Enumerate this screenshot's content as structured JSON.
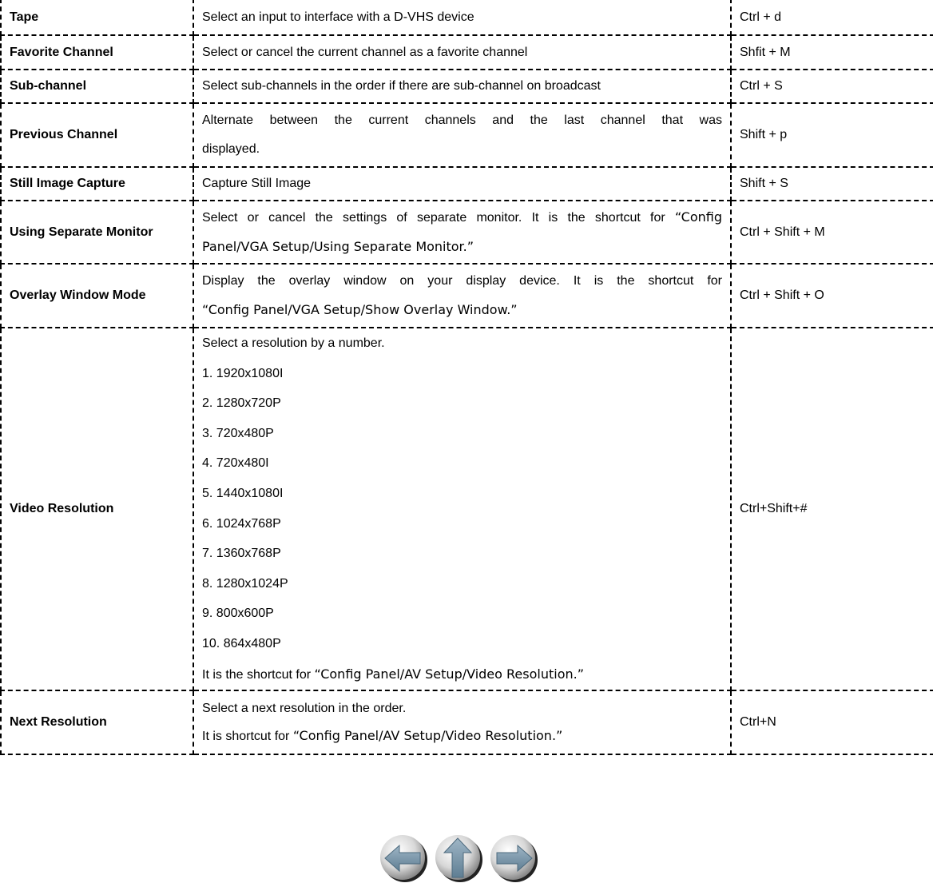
{
  "rows": [
    {
      "name": "Tape",
      "desc": "Select an input to interface with a D-VHS device",
      "shortcut": "Ctrl + d"
    },
    {
      "name": "Favorite Channel",
      "desc": "Select or cancel the current channel as a favorite channel",
      "shortcut": "Shfit + M"
    },
    {
      "name": "Sub-channel",
      "desc": "Select sub-channels in the order if there are sub-channel on broadcast",
      "shortcut": "Ctrl + S"
    },
    {
      "name": "Previous Channel",
      "desc": "Alternate between the current channels and the last channel that was",
      "desc2": "displayed.",
      "shortcut": "Shift + p"
    },
    {
      "name": "Still Image Capture",
      "desc": "Capture Still Image",
      "shortcut": "Shift + S"
    },
    {
      "name": "Using Separate Monitor",
      "desc": "Select or cancel the settings of separate monitor. It is the shortcut for ",
      "desc_ref": "“Config",
      "desc2": "Panel/VGA Setup/Using Separate Monitor.”",
      "shortcut": "Ctrl + Shift + M"
    },
    {
      "name": "Overlay Window Mode",
      "desc": "Display the overlay window on your display device. It is the shortcut for",
      "desc2": "“Config Panel/VGA Setup/Show Overlay Window.”",
      "shortcut": "Ctrl + Shift + O"
    },
    {
      "name": "Video Resolution",
      "desc": "Select a resolution by a number.",
      "list": [
        "1. 1920x1080I",
        "2. 1280x720P",
        "3. 720x480P",
        "4. 720x480I",
        "5. 1440x1080I",
        "6. 1024x768P",
        "7. 1360x768P",
        "8. 1280x1024P",
        "9. 800x600P",
        "10. 864x480P"
      ],
      "desc_tail": "It is the shortcut for ",
      "desc_ref": "“Config Panel/AV Setup/Video Resolution.”",
      "shortcut": "Ctrl+Shift+#"
    },
    {
      "name": "Next Resolution",
      "desc": "Select a next resolution in the order.",
      "desc_tail": "It is shortcut for ",
      "desc_ref": "“Config Panel/AV Setup/Video Resolution.”",
      "shortcut": "Ctrl+N"
    }
  ],
  "nav": {
    "icons": [
      "arrow-left-icon",
      "arrow-up-icon",
      "arrow-right-icon"
    ]
  }
}
